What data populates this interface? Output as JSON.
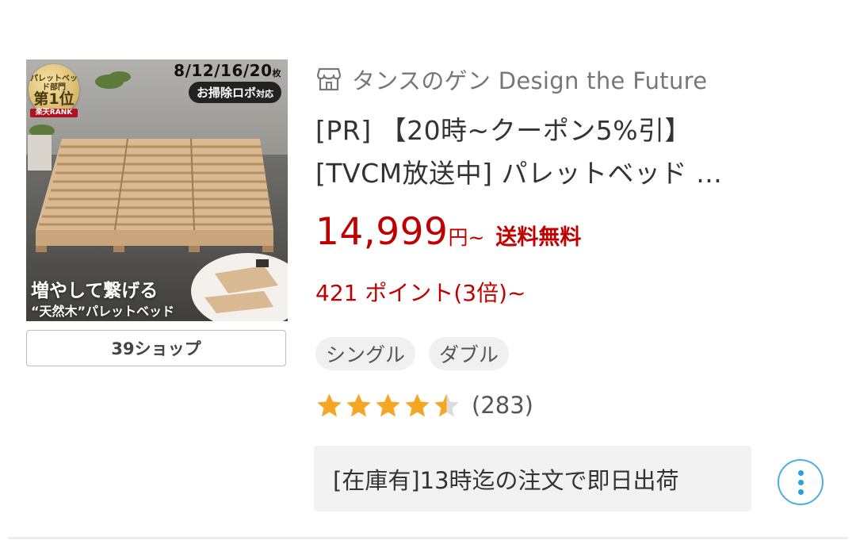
{
  "product_image": {
    "rank_badge": {
      "line1": "パレットベッド部門",
      "line2": "第1位",
      "line3": "楽天RANK"
    },
    "sizes": "8/12/16/20",
    "sizes_suffix": "枚",
    "robot_text": "お掃除ロボ",
    "robot_suffix": "対応",
    "copy_line1": "増やして繋げる",
    "copy_line2": "“天然木”パレットベッド"
  },
  "shop_button": {
    "label": "39ショップ"
  },
  "seller": {
    "icon": "shop-icon",
    "name": "タンスのゲン Design the Future"
  },
  "title": {
    "line1": "[PR] 【20時~クーポン5%引】",
    "line2": "[TVCM放送中] パレットベッド …"
  },
  "price": {
    "amount": "14,999",
    "unit": "円~",
    "shipping": "送料無料"
  },
  "points": {
    "text": "421 ポイント(3倍)~"
  },
  "variants": [
    "シングル",
    "ダブル"
  ],
  "rating": {
    "stars": 4.5,
    "count": "(283)",
    "color": "#f5a623",
    "empty_color": "#dcdcdc"
  },
  "stock": {
    "text": "[在庫有]13時迄の注文で即日出荷"
  },
  "more": {
    "icon": "more-vertical-icon"
  },
  "colors": {
    "price": "#bf0000",
    "accent": "#2b9fd8"
  }
}
